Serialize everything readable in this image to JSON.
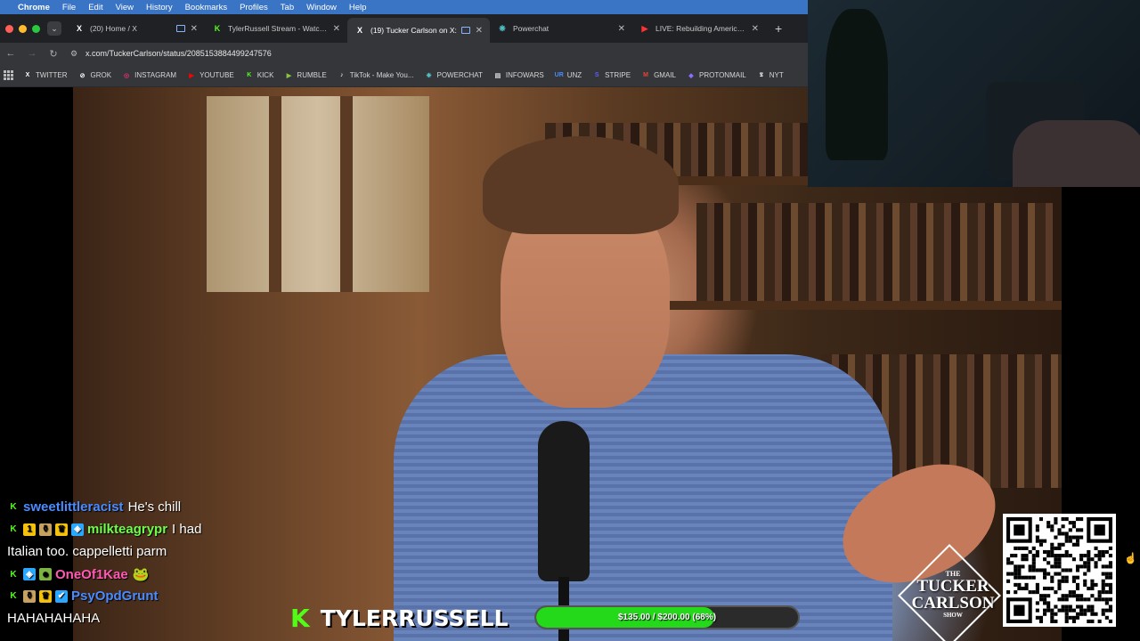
{
  "menubar": {
    "app": "Chrome",
    "items": [
      "File",
      "Edit",
      "View",
      "History",
      "Bookmarks",
      "Profiles",
      "Tab",
      "Window",
      "Help"
    ]
  },
  "tabs": [
    {
      "title": "(20) Home / X",
      "favicon": "x-logo-icon",
      "fav_text": "X",
      "active": false
    },
    {
      "title": "TylerRussell Stream - Watch Li",
      "favicon": "kick-logo-icon",
      "fav_text": "K",
      "active": false
    },
    {
      "title": "(19) Tucker Carlson on X:",
      "favicon": "x-logo-icon",
      "fav_text": "X",
      "active": true
    },
    {
      "title": "Powerchat",
      "favicon": "powerchat-icon",
      "fav_text": "❋",
      "active": false
    },
    {
      "title": "LIVE: Rebuilding America After",
      "favicon": "youtube-icon",
      "fav_text": "▶",
      "active": false
    }
  ],
  "address_bar": {
    "url": "x.com/TuckerCarlson/status/2085153884499247576"
  },
  "bookmarks": [
    {
      "label": "TWITTER",
      "icon": "x-logo-icon",
      "glyph": "X"
    },
    {
      "label": "GROK",
      "icon": "grok-icon",
      "glyph": "⊘"
    },
    {
      "label": "INSTAGRAM",
      "icon": "instagram-icon",
      "glyph": "◎"
    },
    {
      "label": "YOUTUBE",
      "icon": "youtube-icon",
      "glyph": "▶"
    },
    {
      "label": "KICK",
      "icon": "kick-logo-icon",
      "glyph": "K"
    },
    {
      "label": "RUMBLE",
      "icon": "rumble-icon",
      "glyph": "▶"
    },
    {
      "label": "TikTok - Make You...",
      "icon": "tiktok-icon",
      "glyph": "♪"
    },
    {
      "label": "POWERCHAT",
      "icon": "powerchat-icon",
      "glyph": "❋"
    },
    {
      "label": "INFOWARS",
      "icon": "infowars-icon",
      "glyph": "▤"
    },
    {
      "label": "UNZ",
      "icon": "unz-icon",
      "glyph": "UR"
    },
    {
      "label": "STRIPE",
      "icon": "stripe-icon",
      "glyph": "S"
    },
    {
      "label": "GMAIL",
      "icon": "gmail-icon",
      "glyph": "M"
    },
    {
      "label": "PROTONMAIL",
      "icon": "protonmail-icon",
      "glyph": "◆"
    },
    {
      "label": "NYT",
      "icon": "nyt-icon",
      "glyph": "𝕿"
    }
  ],
  "chat": [
    {
      "user": "sweetlittleracist",
      "user_color": "#4a8cff",
      "message": "He's chill",
      "badges": [
        "K"
      ]
    },
    {
      "user": "milkteagrypr",
      "user_color": "#6bff4a",
      "message": "I had",
      "badges": [
        "K",
        "1",
        "⚱",
        "♛",
        "◈"
      ]
    },
    {
      "user": "",
      "user_color": "#ffffff",
      "message": "Italian too. cappelletti parm",
      "badges": []
    },
    {
      "user": "OneOf1Kae",
      "user_color": "#ff5ab4",
      "message": "🐸",
      "badges": [
        "K",
        "◈",
        "☻"
      ]
    },
    {
      "user": "PsyOpdGrunt",
      "user_color": "#4a8cff",
      "message": "",
      "badges": [
        "K",
        "⚱",
        "♛",
        "✔"
      ]
    },
    {
      "user": "",
      "user_color": "#ffffff",
      "message": "HAHAHAHAHA",
      "badges": []
    }
  ],
  "stream": {
    "channel_logo": "K",
    "channel_name": "TYLERRUSSELL",
    "goal_text": "$135.00 / $200.00 (68%)",
    "goal_fraction": 0.68
  },
  "show_logo": {
    "line1": "THE",
    "line2": "TUCKER",
    "line3": "CARLSON",
    "line4": "SHOW"
  },
  "colors": {
    "accent": "#53fc18",
    "goal_fill": "#24d81a",
    "menubar": "#3a74c4"
  }
}
